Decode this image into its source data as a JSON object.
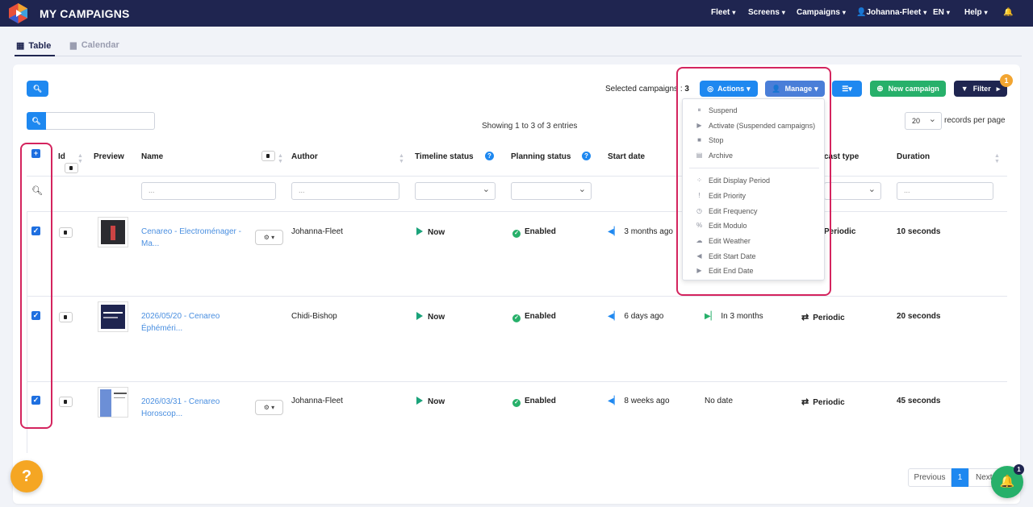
{
  "app": {
    "title": "MY CAMPAIGNS"
  },
  "nav": {
    "fleet": "Fleet",
    "screens": "Screens",
    "campaigns": "Campaigns",
    "user": "Johanna-Fleet",
    "lang": "EN",
    "help": "Help"
  },
  "views": {
    "table": "Table",
    "calendar": "Calendar"
  },
  "toolbar": {
    "selected_label": "Selected campaigns :",
    "selected_count": "3",
    "actions_label": "Actions",
    "manage_label": "Manage",
    "new_campaign_label": "New campaign",
    "filter_label": "Filter",
    "filter_badge": "1"
  },
  "table_info": {
    "showing": "Showing 1 to 3 of 3 entries",
    "page_size": "20",
    "records_label": "records per page"
  },
  "columns": {
    "id": "Id",
    "preview": "Preview",
    "name": "Name",
    "author": "Author",
    "timeline": "Timeline status",
    "planning": "Planning status",
    "start": "Start date",
    "broadcast": "cast type",
    "duration": "Duration"
  },
  "filters": {
    "name_placeholder": "...",
    "author_placeholder": "...",
    "duration_placeholder": "..."
  },
  "rows": [
    {
      "name1": "Cenareo - Electroménager -",
      "name2": "Ma...",
      "author": "Johanna-Fleet",
      "timeline": "Now",
      "planning": "Enabled",
      "start": "3 months ago",
      "end": "",
      "type": "Periodic",
      "duration": "10 seconds"
    },
    {
      "name1": "2026/05/20 - Cenareo",
      "name2": "Éphéméri...",
      "author": "Chidi-Bishop",
      "timeline": "Now",
      "planning": "Enabled",
      "start": "6 days ago",
      "end": "In 3 months",
      "type": "Periodic",
      "duration": "20 seconds"
    },
    {
      "name1": "2026/03/31 - Cenareo",
      "name2": "Horoscop...",
      "author": "Johanna-Fleet",
      "timeline": "Now",
      "planning": "Enabled",
      "start": "8 weeks ago",
      "end": "No date",
      "type": "Periodic",
      "duration": "45 seconds"
    }
  ],
  "manage_menu": {
    "items": [
      "Suspend",
      "Activate (Suspended campaigns)",
      "Stop",
      "Archive"
    ],
    "edit_items": [
      "Edit Display Period",
      "Edit Priority",
      "Edit Frequency",
      "Edit Modulo",
      "Edit Weather",
      "Edit Start Date",
      "Edit End Date"
    ]
  },
  "pagination": {
    "previous": "Previous",
    "current": "1",
    "next": "Next"
  },
  "notifications": {
    "badge": "1"
  },
  "help_fab": "?",
  "colors": {
    "topbar": "#1f2550",
    "primary": "#1e88f0",
    "manage": "#4a7ed8",
    "success": "#27b06a",
    "dark_button": "#1f2550",
    "highlight": "#d4245e"
  }
}
